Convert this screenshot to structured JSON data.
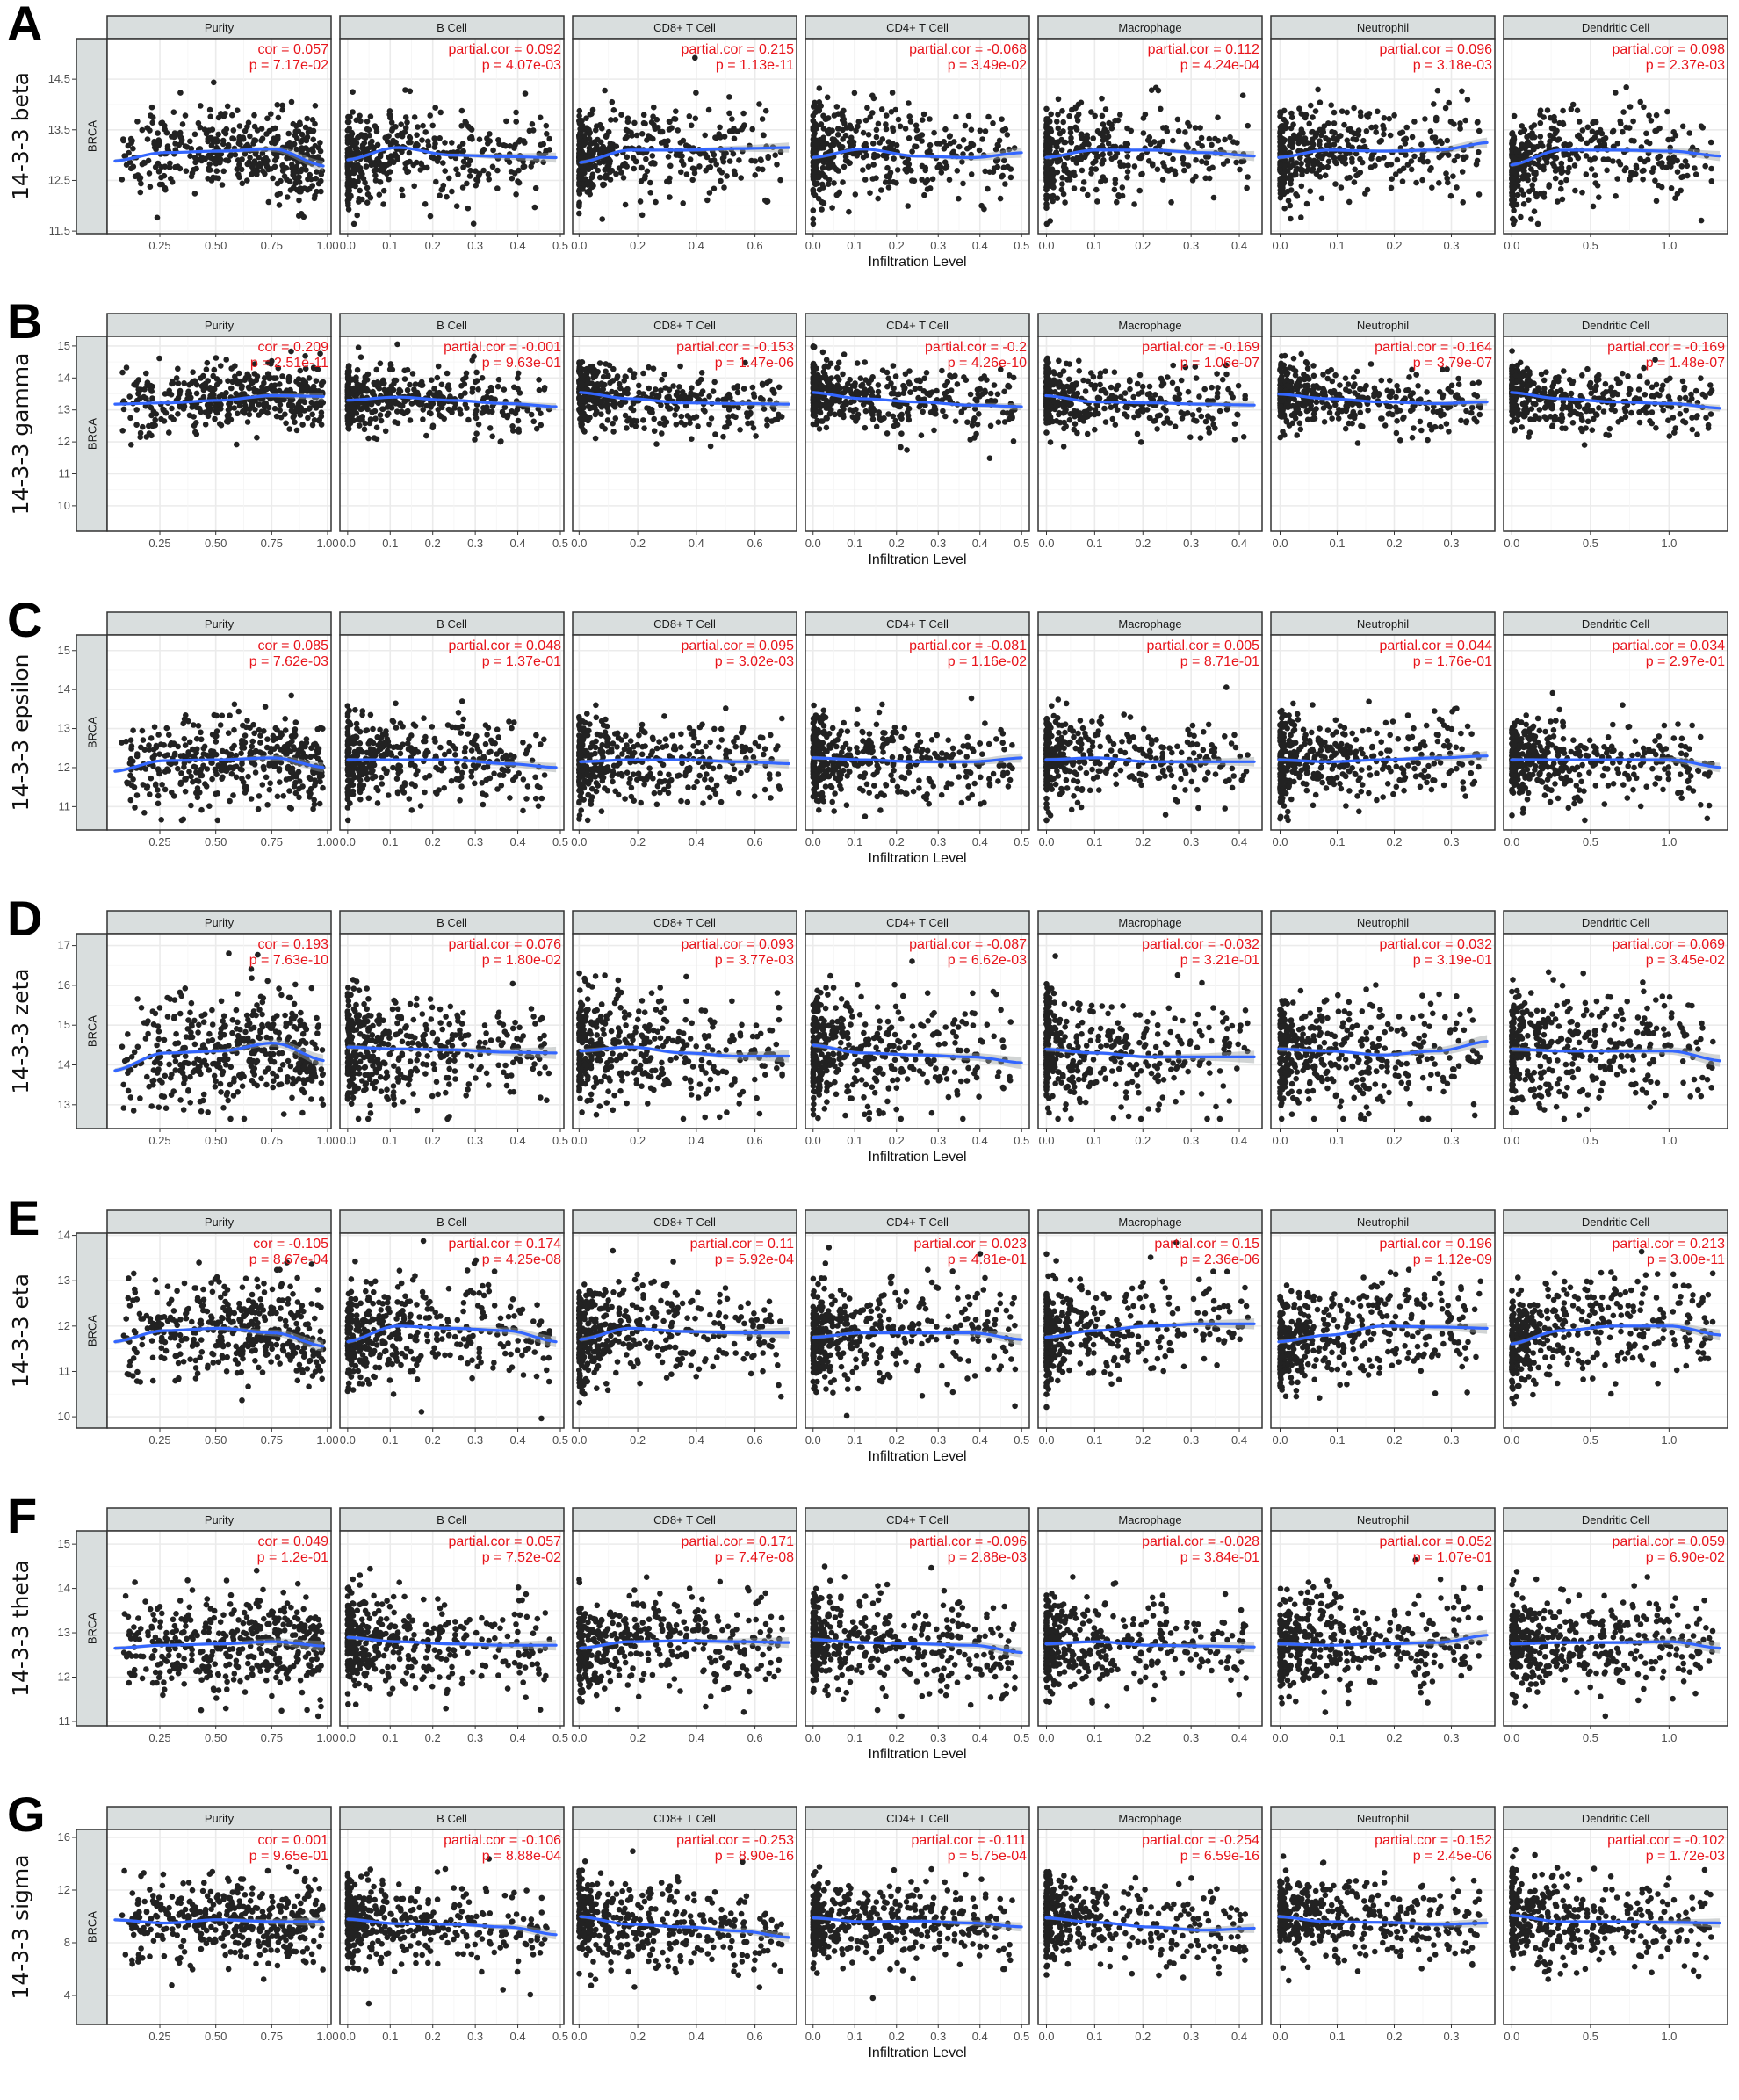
{
  "figure": {
    "colors": {
      "point": "#222222",
      "smooth": "#3366ff",
      "ribbon": "#9aa0a0",
      "stat_text": "#e8141b",
      "strip_fill": "#d9dede",
      "panel_border": "#333333",
      "grid_major": "#ebebeb",
      "grid_minor": "#f5f5f5"
    },
    "x_axis_label": "Infiltration Level",
    "row_strip_label": "BRCA"
  },
  "chart_data": {
    "type": "scatter",
    "title": "",
    "xlabel": "Infiltration Level",
    "grid": true,
    "facets": [
      {
        "name": "Purity",
        "stat_prefix": "cor",
        "xlim": [
          0.03,
          1.0
        ],
        "ticks": [
          0.25,
          0.5,
          0.75,
          1.0
        ],
        "tick_labels": [
          "0.25",
          "0.50",
          "0.75",
          "1.00"
        ]
      },
      {
        "name": "B Cell",
        "stat_prefix": "partial.cor",
        "xlim": [
          -0.01,
          0.5
        ],
        "ticks": [
          0.0,
          0.1,
          0.2,
          0.3,
          0.4,
          0.5
        ],
        "tick_labels": [
          "0.0",
          "0.1",
          "0.2",
          "0.3",
          "0.4",
          "0.5"
        ]
      },
      {
        "name": "CD8+ T Cell",
        "stat_prefix": "partial.cor",
        "xlim": [
          -0.01,
          0.73
        ],
        "ticks": [
          0.0,
          0.2,
          0.4,
          0.6
        ],
        "tick_labels": [
          "0.0",
          "0.2",
          "0.4",
          "0.6"
        ]
      },
      {
        "name": "CD4+ T Cell",
        "stat_prefix": "partial.cor",
        "xlim": [
          -0.01,
          0.51
        ],
        "ticks": [
          0.0,
          0.1,
          0.2,
          0.3,
          0.4,
          0.5
        ],
        "tick_labels": [
          "0.0",
          "0.1",
          "0.2",
          "0.3",
          "0.4",
          "0.5"
        ]
      },
      {
        "name": "Macrophage",
        "stat_prefix": "partial.cor",
        "xlim": [
          -0.01,
          0.44
        ],
        "ticks": [
          0.0,
          0.1,
          0.2,
          0.3,
          0.4
        ],
        "tick_labels": [
          "0.0",
          "0.1",
          "0.2",
          "0.3",
          "0.4"
        ]
      },
      {
        "name": "Neutrophil",
        "stat_prefix": "partial.cor",
        "xlim": [
          -0.01,
          0.37
        ],
        "ticks": [
          0.0,
          0.1,
          0.2,
          0.3
        ],
        "tick_labels": [
          "0.0",
          "0.1",
          "0.2",
          "0.3"
        ]
      },
      {
        "name": "Dendritic Cell",
        "stat_prefix": "partial.cor",
        "xlim": [
          -0.03,
          1.35
        ],
        "ticks": [
          0.0,
          0.5,
          1.0
        ],
        "tick_labels": [
          "0.0",
          "0.5",
          "1.0"
        ]
      }
    ],
    "rows": [
      {
        "letter": "A",
        "gene": "14-3-3 beta",
        "cancer": "BRCA",
        "ylim": [
          11.45,
          15.3
        ],
        "yticks": [
          11.5,
          12.5,
          13.5,
          14.5
        ],
        "ytick_labels": [
          "11.5",
          "12.5",
          "13.5",
          "14.5"
        ],
        "center": 13.0,
        "spread": 0.45,
        "stats": [
          {
            "cor": "0.057",
            "p": "7.17e-02"
          },
          {
            "cor": "0.092",
            "p": "4.07e-03"
          },
          {
            "cor": "0.215",
            "p": "1.13e-11"
          },
          {
            "cor": "-0.068",
            "p": "3.49e-02"
          },
          {
            "cor": "0.112",
            "p": "4.24e-04"
          },
          {
            "cor": "0.096",
            "p": "3.18e-03"
          },
          {
            "cor": "0.098",
            "p": "2.37e-03"
          }
        ],
        "smooth": [
          [
            12.88,
            13.05,
            13.08,
            13.12,
            12.78
          ],
          [
            12.9,
            13.15,
            13.0,
            12.97,
            12.95
          ],
          [
            12.85,
            13.1,
            13.1,
            13.13,
            13.15
          ],
          [
            12.95,
            13.12,
            12.98,
            12.95,
            13.05
          ],
          [
            12.95,
            13.1,
            13.1,
            13.05,
            12.98
          ],
          [
            12.95,
            13.1,
            13.08,
            13.1,
            13.25
          ],
          [
            12.8,
            13.1,
            13.1,
            13.08,
            12.98
          ]
        ]
      },
      {
        "letter": "B",
        "gene": "14-3-3 gamma",
        "cancer": "BRCA",
        "ylim": [
          9.2,
          15.3
        ],
        "yticks": [
          10,
          11,
          12,
          13,
          14,
          15
        ],
        "ytick_labels": [
          "10",
          "11",
          "12",
          "13",
          "14",
          "15"
        ],
        "center": 13.3,
        "spread": 0.5,
        "stats": [
          {
            "cor": "0.209",
            "p": "2.51e-11"
          },
          {
            "cor": "-0.001",
            "p": "9.63e-01"
          },
          {
            "cor": "-0.153",
            "p": "1.47e-06"
          },
          {
            "cor": "-0.2",
            "p": "4.26e-10"
          },
          {
            "cor": "-0.169",
            "p": "1.06e-07"
          },
          {
            "cor": "-0.164",
            "p": "3.79e-07"
          },
          {
            "cor": "-0.169",
            "p": "1.48e-07"
          }
        ],
        "smooth": [
          [
            13.18,
            13.22,
            13.3,
            13.45,
            13.42
          ],
          [
            13.3,
            13.4,
            13.3,
            13.2,
            13.1
          ],
          [
            13.55,
            13.35,
            13.22,
            13.2,
            13.18
          ],
          [
            13.55,
            13.35,
            13.25,
            13.15,
            13.1
          ],
          [
            13.45,
            13.25,
            13.22,
            13.18,
            13.15
          ],
          [
            13.5,
            13.35,
            13.25,
            13.2,
            13.25
          ],
          [
            13.55,
            13.35,
            13.25,
            13.2,
            13.05
          ]
        ]
      },
      {
        "letter": "C",
        "gene": "14-3-3 epsilon",
        "cancer": "BRCA",
        "ylim": [
          10.4,
          15.4
        ],
        "yticks": [
          11,
          12,
          13,
          14,
          15
        ],
        "ytick_labels": [
          "11",
          "12",
          "13",
          "14",
          "15"
        ],
        "center": 12.2,
        "spread": 0.55,
        "stats": [
          {
            "cor": "0.085",
            "p": "7.62e-03"
          },
          {
            "cor": "0.048",
            "p": "1.37e-01"
          },
          {
            "cor": "0.095",
            "p": "3.02e-03"
          },
          {
            "cor": "-0.081",
            "p": "1.16e-02"
          },
          {
            "cor": "0.005",
            "p": "8.71e-01"
          },
          {
            "cor": "0.044",
            "p": "1.76e-01"
          },
          {
            "cor": "0.034",
            "p": "2.97e-01"
          }
        ],
        "smooth": [
          [
            11.9,
            12.18,
            12.2,
            12.25,
            12.0
          ],
          [
            12.2,
            12.2,
            12.2,
            12.1,
            12.0
          ],
          [
            12.15,
            12.2,
            12.2,
            12.15,
            12.1
          ],
          [
            12.25,
            12.2,
            12.15,
            12.15,
            12.25
          ],
          [
            12.2,
            12.25,
            12.15,
            12.15,
            12.15
          ],
          [
            12.2,
            12.15,
            12.2,
            12.25,
            12.3
          ],
          [
            12.2,
            12.2,
            12.2,
            12.2,
            12.0
          ]
        ]
      },
      {
        "letter": "D",
        "gene": "14-3-3 zeta",
        "cancer": "BRCA",
        "ylim": [
          12.4,
          17.3
        ],
        "yticks": [
          13,
          14,
          15,
          16,
          17
        ],
        "ytick_labels": [
          "13",
          "14",
          "15",
          "16",
          "17"
        ],
        "center": 14.4,
        "spread": 0.7,
        "stats": [
          {
            "cor": "0.193",
            "p": "7.63e-10"
          },
          {
            "cor": "0.076",
            "p": "1.80e-02"
          },
          {
            "cor": "0.093",
            "p": "3.77e-03"
          },
          {
            "cor": "-0.087",
            "p": "6.62e-03"
          },
          {
            "cor": "-0.032",
            "p": "3.21e-01"
          },
          {
            "cor": "0.032",
            "p": "3.19e-01"
          },
          {
            "cor": "0.069",
            "p": "3.45e-02"
          }
        ],
        "smooth": [
          [
            13.85,
            14.3,
            14.35,
            14.55,
            14.1
          ],
          [
            14.45,
            14.4,
            14.38,
            14.32,
            14.3
          ],
          [
            14.35,
            14.45,
            14.3,
            14.22,
            14.22
          ],
          [
            14.5,
            14.3,
            14.25,
            14.2,
            14.05
          ],
          [
            14.4,
            14.3,
            14.2,
            14.2,
            14.2
          ],
          [
            14.4,
            14.35,
            14.25,
            14.35,
            14.6
          ],
          [
            14.4,
            14.35,
            14.35,
            14.35,
            14.1
          ]
        ]
      },
      {
        "letter": "E",
        "gene": "14-3-3 eta",
        "cancer": "BRCA",
        "ylim": [
          9.75,
          14.05
        ],
        "yticks": [
          10,
          11,
          12,
          13,
          14
        ],
        "ytick_labels": [
          "10",
          "11",
          "12",
          "13",
          "14"
        ],
        "center": 11.85,
        "spread": 0.55,
        "stats": [
          {
            "cor": "-0.105",
            "p": "8.67e-04"
          },
          {
            "cor": "0.174",
            "p": "4.25e-08"
          },
          {
            "cor": "0.11",
            "p": "5.92e-04"
          },
          {
            "cor": "0.023",
            "p": "4.81e-01"
          },
          {
            "cor": "0.15",
            "p": "2.36e-06"
          },
          {
            "cor": "0.196",
            "p": "1.12e-09"
          },
          {
            "cor": "0.213",
            "p": "3.00e-11"
          }
        ],
        "smooth": [
          [
            11.65,
            11.9,
            11.95,
            11.85,
            11.55
          ],
          [
            11.65,
            12.0,
            11.95,
            11.9,
            11.65
          ],
          [
            11.7,
            11.95,
            11.88,
            11.85,
            11.85
          ],
          [
            11.75,
            11.85,
            11.85,
            11.85,
            11.7
          ],
          [
            11.75,
            11.9,
            12.0,
            12.05,
            12.05
          ],
          [
            11.65,
            11.8,
            12.0,
            11.98,
            11.95
          ],
          [
            11.6,
            11.9,
            12.0,
            12.0,
            11.8
          ]
        ]
      },
      {
        "letter": "F",
        "gene": "14-3-3 theta",
        "cancer": "BRCA",
        "ylim": [
          10.9,
          15.3
        ],
        "yticks": [
          11,
          12,
          13,
          14,
          15
        ],
        "ytick_labels": [
          "11",
          "12",
          "13",
          "14",
          "15"
        ],
        "center": 12.75,
        "spread": 0.55,
        "stats": [
          {
            "cor": "0.049",
            "p": "1.2e-01"
          },
          {
            "cor": "0.057",
            "p": "7.52e-02"
          },
          {
            "cor": "0.171",
            "p": "7.47e-08"
          },
          {
            "cor": "-0.096",
            "p": "2.88e-03"
          },
          {
            "cor": "-0.028",
            "p": "3.84e-01"
          },
          {
            "cor": "0.052",
            "p": "1.07e-01"
          },
          {
            "cor": "0.059",
            "p": "6.90e-02"
          }
        ],
        "smooth": [
          [
            12.65,
            12.72,
            12.75,
            12.8,
            12.7
          ],
          [
            12.9,
            12.8,
            12.75,
            12.72,
            12.72
          ],
          [
            12.65,
            12.8,
            12.82,
            12.8,
            12.78
          ],
          [
            12.85,
            12.78,
            12.75,
            12.72,
            12.55
          ],
          [
            12.75,
            12.8,
            12.72,
            12.7,
            12.68
          ],
          [
            12.75,
            12.72,
            12.75,
            12.78,
            12.95
          ],
          [
            12.75,
            12.78,
            12.78,
            12.8,
            12.65
          ]
        ]
      },
      {
        "letter": "G",
        "gene": "14-3-3 sigma",
        "cancer": "BRCA",
        "ylim": [
          1.8,
          16.6
        ],
        "yticks": [
          4,
          8,
          12,
          16
        ],
        "ytick_labels": [
          "4",
          "8",
          "12",
          "16"
        ],
        "center": 9.6,
        "spread": 1.6,
        "stats": [
          {
            "cor": "0.001",
            "p": "9.65e-01"
          },
          {
            "cor": "-0.106",
            "p": "8.88e-04"
          },
          {
            "cor": "-0.253",
            "p": "8.90e-16"
          },
          {
            "cor": "-0.111",
            "p": "5.75e-04"
          },
          {
            "cor": "-0.254",
            "p": "6.59e-16"
          },
          {
            "cor": "-0.152",
            "p": "2.45e-06"
          },
          {
            "cor": "-0.102",
            "p": "1.72e-03"
          }
        ],
        "smooth": [
          [
            9.75,
            9.5,
            9.75,
            9.6,
            9.6
          ],
          [
            9.8,
            9.45,
            9.4,
            9.2,
            8.6
          ],
          [
            10.0,
            9.4,
            9.2,
            8.9,
            8.4
          ],
          [
            9.9,
            9.6,
            9.65,
            9.5,
            9.2
          ],
          [
            9.9,
            9.55,
            9.2,
            8.95,
            9.1
          ],
          [
            10.0,
            9.6,
            9.55,
            9.4,
            9.5
          ],
          [
            10.1,
            9.6,
            9.6,
            9.55,
            9.5
          ]
        ]
      }
    ]
  }
}
